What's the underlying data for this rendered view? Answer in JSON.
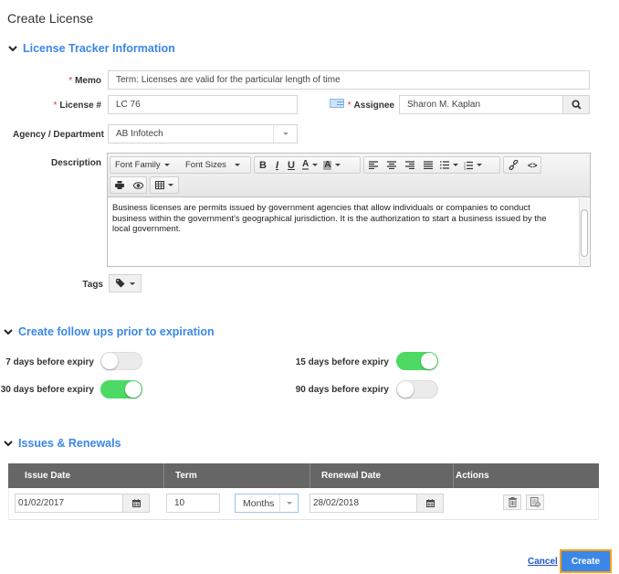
{
  "page": {
    "title": "Create License"
  },
  "sections": {
    "info": {
      "title": "License Tracker Information",
      "memo": {
        "label": "Memo",
        "required": "*",
        "value": "Term: Licenses are valid for the particular length of time"
      },
      "license": {
        "label": "License #",
        "required": "*",
        "value": "LC 76"
      },
      "assignee": {
        "label": "Assignee",
        "required": "*",
        "value": "Sharon M. Kaplan",
        "icon": "contact-card-icon",
        "search_icon": "search-icon"
      },
      "agency": {
        "label": "Agency / Department",
        "value": "AB Infotech"
      },
      "description": {
        "label": "Description",
        "toolbar": {
          "font_family": "Font Family",
          "font_sizes": "Font Sizes",
          "bold": "B",
          "italic": "I",
          "underline": "U",
          "font_color": "A",
          "bg_color": "A"
        },
        "text": "Business licenses are permits issued by government agencies that allow individuals or companies to conduct business within the government's geographical jurisdiction. It is the authorization to start a business issued by the local government."
      },
      "tags": {
        "label": "Tags"
      }
    },
    "followups": {
      "title": "Create follow ups prior to expiration",
      "toggles": [
        {
          "label": "7 days before expiry",
          "on": false
        },
        {
          "label": "15 days before expiry",
          "on": true
        },
        {
          "label": "30 days before expiry",
          "on": true
        },
        {
          "label": "90 days before expiry",
          "on": false
        }
      ]
    },
    "renewals": {
      "title": "Issues & Renewals",
      "columns": [
        "Issue Date",
        "Term",
        "Renewal Date",
        "Actions"
      ],
      "rows": [
        {
          "issue_date": "01/02/2017",
          "term": "10",
          "term_unit": "Months",
          "renewal_date": "28/02/2018"
        }
      ]
    }
  },
  "footer": {
    "cancel_label": "Cancel",
    "create_label": "Create"
  },
  "colors": {
    "accent": "#3a87e8",
    "toggle_on": "#4cd964",
    "focus_outline": "#f7a11a",
    "table_header": "#666666"
  }
}
